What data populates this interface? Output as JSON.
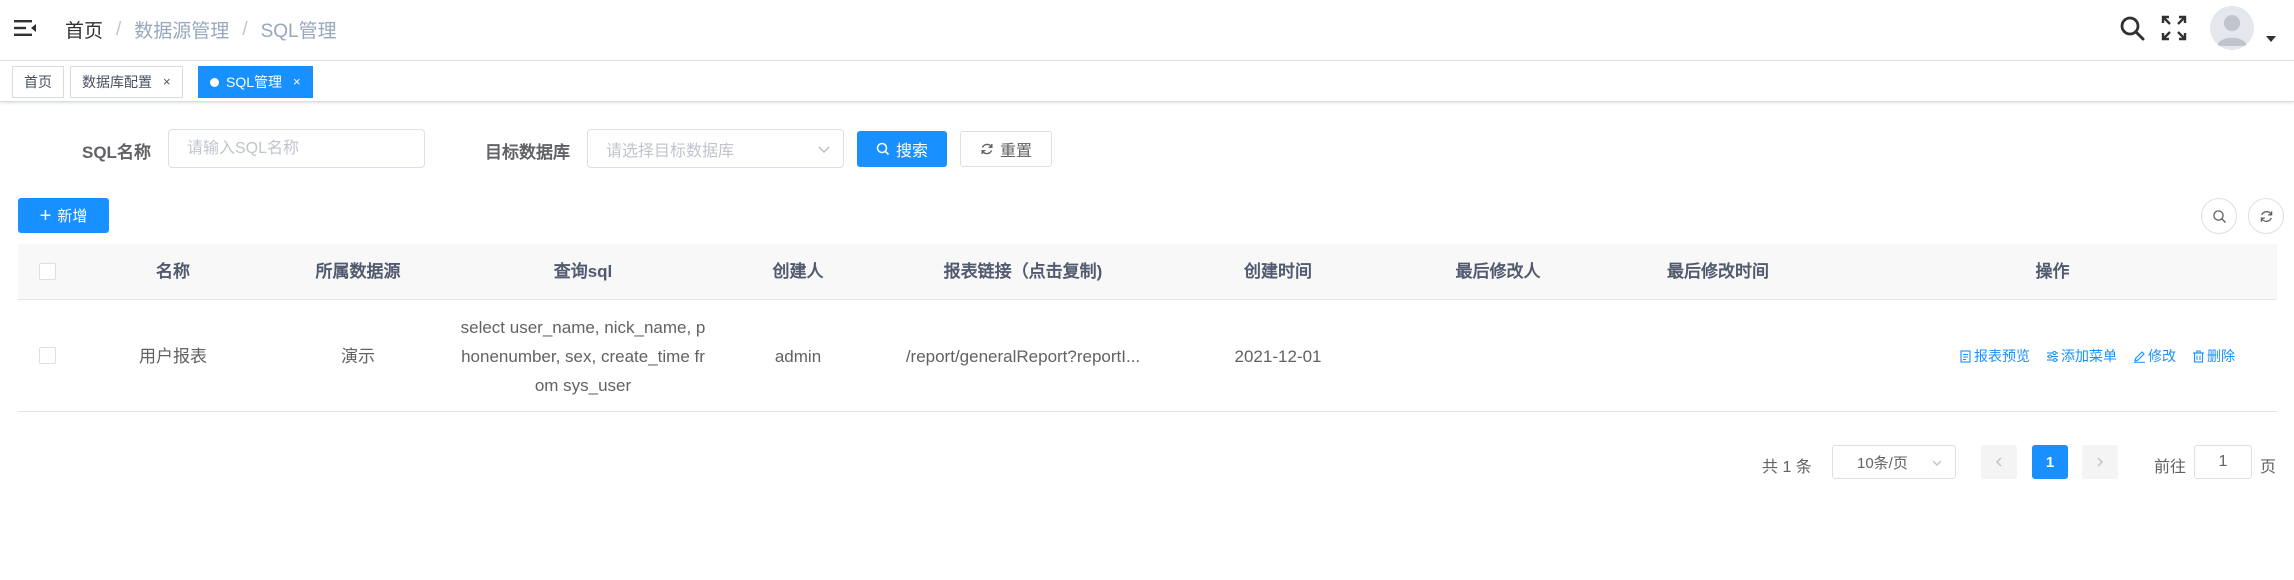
{
  "breadcrumb": {
    "items": [
      "首页",
      "数据源管理",
      "SQL管理"
    ],
    "separator": "/"
  },
  "tags": [
    {
      "label": "首页",
      "closable": false,
      "active": false
    },
    {
      "label": "数据库配置",
      "closable": true,
      "active": false
    },
    {
      "label": "SQL管理",
      "closable": true,
      "active": true
    }
  ],
  "tag_close_glyph": "×",
  "search": {
    "sql_name_label": "SQL名称",
    "sql_name_placeholder": "请输入SQL名称",
    "sql_name_value": "",
    "target_db_label": "目标数据库",
    "target_db_placeholder": "请选择目标数据库",
    "search_button": "搜索",
    "reset_button": "重置"
  },
  "toolbar": {
    "add_button": "新增",
    "add_glyph": "+"
  },
  "table": {
    "columns": [
      "名称",
      "所属数据源",
      "查询sql",
      "创建人",
      "报表链接（点击复制)",
      "创建时间",
      "最后修改人",
      "最后修改时间",
      "操作"
    ],
    "rows": [
      {
        "name": "用户报表",
        "datasource": "演示",
        "sql_lines": [
          "select user_name, nick_name, p",
          "honenumber, sex, create_time fr",
          "om sys_user"
        ],
        "creator": "admin",
        "report_link": "/report/generalReport?reportI...",
        "created_at": "2021-12-01",
        "modified_by": "",
        "modified_at": "",
        "actions": {
          "preview": "报表预览",
          "add_menu": "添加菜单",
          "edit": "修改",
          "delete": "删除"
        }
      }
    ]
  },
  "pagination": {
    "total_text": "共 1 条",
    "page_size": "10条/页",
    "current_page": "1",
    "goto_label": "前往",
    "goto_value": "1",
    "page_unit": "页"
  },
  "colors": {
    "primary": "#1890ff",
    "header_text": "#515a6e",
    "muted": "#97a8be"
  },
  "icons": {
    "hamburger": "hamburger-icon",
    "search": "search-icon",
    "fullscreen": "fullscreen-icon",
    "avatar": "user-avatar-icon"
  }
}
